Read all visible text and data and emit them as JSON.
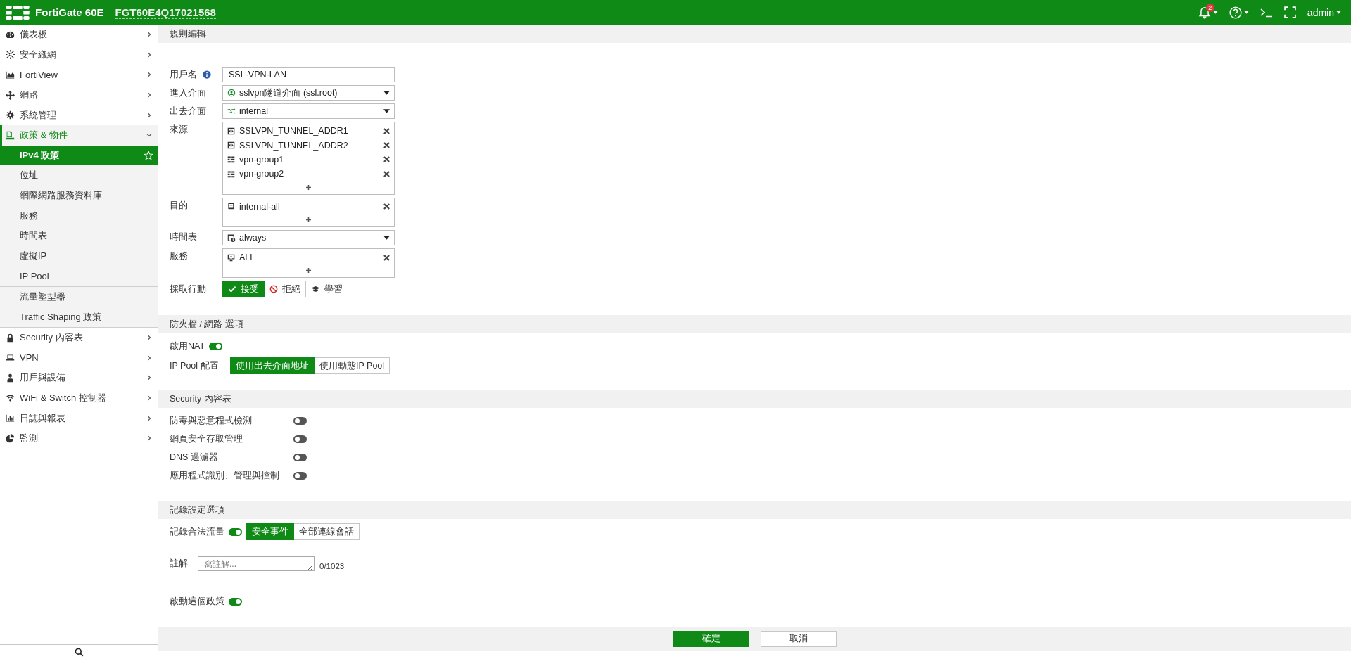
{
  "top_bar": {
    "product": "FortiGate 60E",
    "serial": "FGT60E4Q17021568",
    "notifications": "2",
    "user": "admin"
  },
  "sidebar": {
    "items": [
      {
        "label": "儀表板",
        "expanded": false
      },
      {
        "label": "安全織網",
        "expanded": false
      },
      {
        "label": "FortiView",
        "expanded": false
      },
      {
        "label": "網路",
        "expanded": false
      },
      {
        "label": "系統管理",
        "expanded": false
      },
      {
        "label": "政策 & 物件",
        "expanded": true,
        "child_groups": [
          [
            {
              "label": "IPv4 政策",
              "selected": true
            },
            {
              "label": "位址",
              "selected": false
            },
            {
              "label": "網際網路服務資料庫",
              "selected": false
            },
            {
              "label": "服務",
              "selected": false
            },
            {
              "label": "時間表",
              "selected": false
            },
            {
              "label": "虛擬IP",
              "selected": false
            },
            {
              "label": "IP Pool",
              "selected": false
            }
          ],
          [
            {
              "label": "流量塑型器",
              "selected": false
            },
            {
              "label": "Traffic Shaping 政策",
              "selected": false
            }
          ]
        ]
      },
      {
        "label": "Security 內容表",
        "expanded": false
      },
      {
        "label": "VPN",
        "expanded": false
      },
      {
        "label": "用戶與設備",
        "expanded": false
      },
      {
        "label": "WiFi & Switch 控制器",
        "expanded": false
      },
      {
        "label": "日誌與報表",
        "expanded": false
      },
      {
        "label": "監測",
        "expanded": false
      }
    ]
  },
  "sections": [
    {
      "title": "規則編輯",
      "rows": [
        {
          "kind": "text",
          "label": "用戶名",
          "info": true,
          "value": "SSL-VPN-LAN"
        },
        {
          "kind": "select",
          "label": "進入介面",
          "value": {
            "kind": "tunnel",
            "text": "sslvpn隧道介面 (ssl.root)"
          }
        },
        {
          "kind": "select",
          "label": "出去介面",
          "value": {
            "kind": "interface",
            "text": "internal"
          }
        },
        {
          "kind": "list",
          "label": "來源",
          "entries": [
            {
              "kind": "address",
              "name": "SSLVPN_TUNNEL_ADDR1"
            },
            {
              "kind": "address",
              "name": "SSLVPN_TUNNEL_ADDR2"
            },
            {
              "kind": "group",
              "name": "vpn-group1"
            },
            {
              "kind": "group",
              "name": "vpn-group2"
            }
          ]
        },
        {
          "kind": "list",
          "label": "目的",
          "entries": [
            {
              "kind": "interface",
              "name": "internal-all"
            }
          ]
        },
        {
          "kind": "select",
          "label": "時間表",
          "value": {
            "kind": "schedule",
            "text": "always"
          }
        },
        {
          "kind": "list",
          "label": "服務",
          "entries": [
            {
              "kind": "service",
              "name": "ALL"
            }
          ]
        },
        {
          "kind": "segmented",
          "label": "採取行動",
          "options": [
            {
              "label": "接受",
              "kind": "accept",
              "selected": true
            },
            {
              "label": "拒絕",
              "kind": "deny",
              "selected": false
            },
            {
              "label": "學習",
              "kind": "learn",
              "selected": false
            }
          ]
        }
      ]
    },
    {
      "title": "防火牆 / 網路 選項",
      "rows": [
        {
          "kind": "toggle",
          "label": "啟用NAT",
          "on": true
        },
        {
          "kind": "segmented",
          "label": "IP Pool 配置",
          "options": [
            {
              "label": "使用出去介面地址",
              "selected": true
            },
            {
              "label": "使用動態IP Pool",
              "selected": false
            }
          ]
        }
      ]
    },
    {
      "title": "Security 內容表",
      "rows": [
        {
          "kind": "toggle",
          "label": "防毒與惡意程式檢測",
          "on": false
        },
        {
          "kind": "toggle",
          "label": "網頁安全存取管理",
          "on": false
        },
        {
          "kind": "toggle",
          "label": "DNS 過濾器",
          "on": false
        },
        {
          "kind": "toggle",
          "label": "應用程式識別、管理與控制",
          "on": false
        }
      ]
    },
    {
      "title": "記錄設定選項",
      "rows": [
        {
          "kind": "toggle",
          "label": "記錄合法流量",
          "on": true,
          "options": [
            {
              "label": "安全事件",
              "selected": true
            },
            {
              "label": "全部連線會話",
              "selected": false
            }
          ]
        },
        {
          "kind": "textarea",
          "label": "註解",
          "placeholder": "寫註解...",
          "counter": "0/1023"
        },
        {
          "kind": "toggle",
          "label": "啟動這個政策",
          "on": true
        }
      ]
    }
  ],
  "footer": {
    "buttons": [
      {
        "label": "確定",
        "kind": "primary"
      },
      {
        "label": "取消",
        "kind": "secondary"
      }
    ]
  }
}
